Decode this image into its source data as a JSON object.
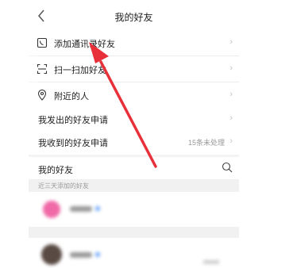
{
  "header": {
    "title": "我的好友",
    "back_icon": "chevron-left-icon"
  },
  "menu": [
    {
      "label": "添加通讯录好友",
      "icon": "contacts-icon"
    },
    {
      "label": "扫一扫加好友",
      "icon": "scan-icon"
    },
    {
      "label": "附近的人",
      "icon": "location-pin-icon"
    }
  ],
  "requests": {
    "sent_label": "我发出的好友申请",
    "received_label": "我收到的好友申请",
    "received_meta": "15条未处理"
  },
  "friends": {
    "section_label": "我的好友",
    "search_icon": "search-icon",
    "recent_label": "近三天添加的好友"
  },
  "colors": {
    "accent_red": "#e8303a",
    "avatar_pink": "#f06aa8",
    "separator": "#ececec"
  }
}
